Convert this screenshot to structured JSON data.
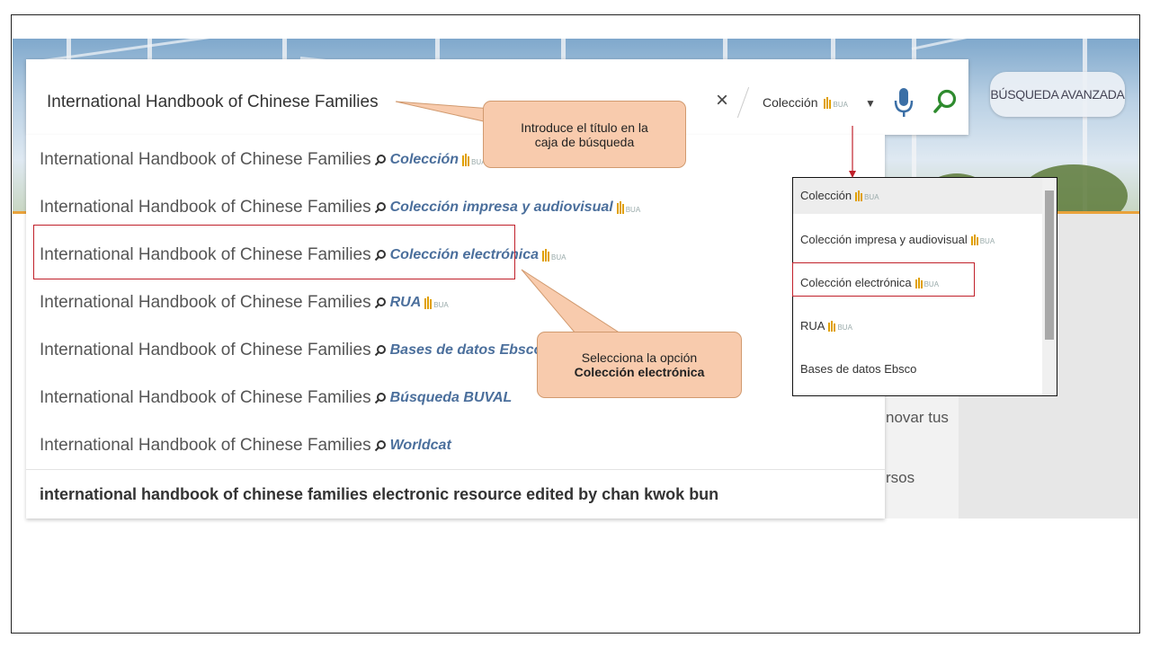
{
  "search": {
    "value": "International Handbook of Chinese Families",
    "clear_label": "×",
    "scope_label": "Colección",
    "advanced_label": "BÚSQUEDA AVANZADA"
  },
  "bua_tag": "BUA",
  "suggestions": [
    {
      "text": "International Handbook of Chinese Families",
      "scope": "Colección",
      "bua": true
    },
    {
      "text": "International Handbook of Chinese Families",
      "scope": "Colección impresa y audiovisual",
      "bua": true
    },
    {
      "text": "International Handbook of Chinese Families",
      "scope": "Colección electrónica",
      "bua": true
    },
    {
      "text": "International Handbook of Chinese Families",
      "scope": "RUA",
      "bua": true
    },
    {
      "text": "International Handbook of Chinese Families",
      "scope": "Bases de datos Ebsco",
      "bua": false
    },
    {
      "text": "International Handbook of Chinese Families",
      "scope": "Búsqueda BUVAL",
      "bua": false
    },
    {
      "text": "International Handbook of Chinese Families",
      "scope": "Worldcat",
      "bua": false
    }
  ],
  "last_suggestion": "international handbook of chinese families electronic resource edited by chan kwok bun",
  "dropdown": {
    "items": [
      {
        "label": "Colección",
        "bua": true
      },
      {
        "label": "Colección impresa y audiovisual",
        "bua": true
      },
      {
        "label": "Colección electrónica",
        "bua": true
      },
      {
        "label": "RUA",
        "bua": true
      },
      {
        "label": "Bases de datos Ebsco",
        "bua": false
      }
    ]
  },
  "background_text": {
    "line1": "novar tus",
    "line2": "rsos"
  },
  "callouts": {
    "title_hint_line1": "Introduce el título en la",
    "title_hint_line2": "caja de búsqueda",
    "select_hint_line1": "Selecciona la opción",
    "select_hint_line2": "Colección electrónica"
  },
  "colors": {
    "accent_orange": "#e9a23b",
    "scope_blue": "#4b6f9c",
    "callout_fill": "#f8cbad",
    "highlight_red": "#c0202a",
    "search_green": "#2e8b2e",
    "mic_blue": "#3b6fa6"
  }
}
